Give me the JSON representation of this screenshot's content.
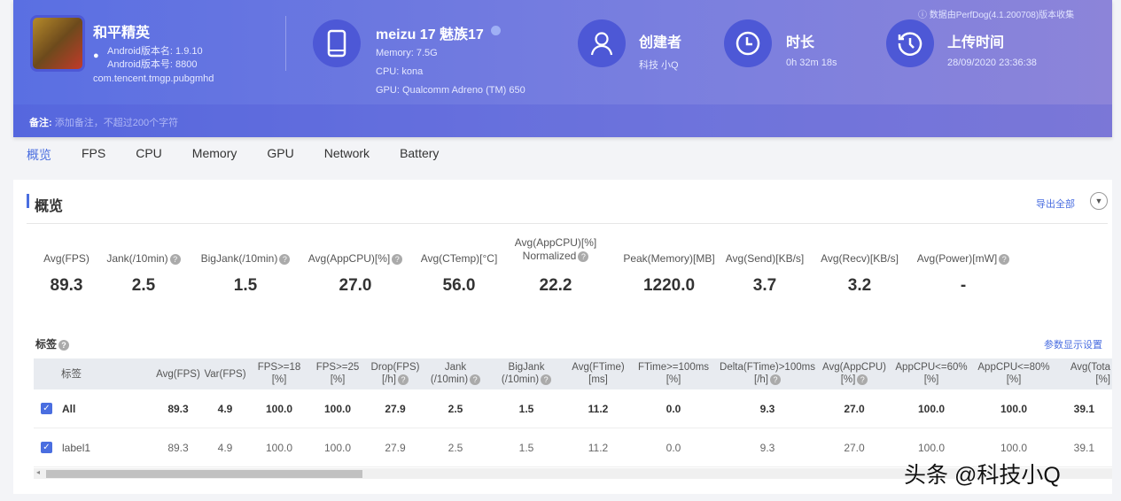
{
  "app": {
    "name": "和平精英",
    "version_name": "Android版本名: 1.9.10",
    "version_code": "Android版本号: 8800",
    "package": "com.tencent.tmgp.pubgmhd"
  },
  "device": {
    "name": "meizu 17 魅族17",
    "memory": "Memory: 7.5G",
    "cpu": "CPU: kona",
    "gpu": "GPU: Qualcomm Adreno (TM) 650"
  },
  "creator": {
    "label": "创建者",
    "value": "科技 小Q"
  },
  "duration": {
    "label": "时长",
    "value": "0h 32m 18s"
  },
  "upload": {
    "label": "上传时间",
    "value": "28/09/2020 23:36:38"
  },
  "perfdog_note": "数据由PerfDog(4.1.200708)版本收集",
  "note": {
    "label": "备注:",
    "placeholder": "添加备注，不超过200个字符"
  },
  "tabs": [
    "概览",
    "FPS",
    "CPU",
    "Memory",
    "GPU",
    "Network",
    "Battery"
  ],
  "section": {
    "title": "概览",
    "export": "导出全部"
  },
  "metrics": [
    {
      "label": "Avg(FPS)",
      "value": "89.3"
    },
    {
      "label": "Jank(/10min)",
      "value": "2.5"
    },
    {
      "label": "BigJank(/10min)",
      "value": "1.5"
    },
    {
      "label": "Avg(AppCPU)[%]",
      "value": "27.0"
    },
    {
      "label": "Avg(CTemp)[°C]",
      "value": "56.0"
    },
    {
      "label": "Avg(AppCPU)[%]",
      "label2": "Normalized",
      "value": "22.2"
    },
    {
      "label": "Peak(Memory)[MB]",
      "value": "1220.0"
    },
    {
      "label": "Avg(Send)[KB/s]",
      "value": "3.7"
    },
    {
      "label": "Avg(Recv)[KB/s]",
      "value": "3.2"
    },
    {
      "label": "Avg(Power)[mW]",
      "value": "-"
    }
  ],
  "labels_section": {
    "title": "标签",
    "settings": "参数显示设置"
  },
  "table": {
    "headers": [
      [
        "标签",
        ""
      ],
      [
        "Avg(FPS)",
        ""
      ],
      [
        "Var(FPS)",
        ""
      ],
      [
        "FPS>=18",
        "[%]"
      ],
      [
        "FPS>=25",
        "[%]"
      ],
      [
        "Drop(FPS)",
        "[/h]"
      ],
      [
        "Jank",
        "(/10min)"
      ],
      [
        "BigJank",
        "(/10min)"
      ],
      [
        "Avg(FTime)",
        "[ms]"
      ],
      [
        "FTime>=100ms",
        "[%]"
      ],
      [
        "Delta(FTime)>100ms",
        "[/h]"
      ],
      [
        "Avg(AppCPU)",
        "[%]"
      ],
      [
        "AppCPU<=60%",
        "[%]"
      ],
      [
        "AppCPU<=80%",
        "[%]"
      ],
      [
        "Avg(Tota",
        "[%]"
      ]
    ],
    "rows": [
      {
        "label": "All",
        "values": [
          "89.3",
          "4.9",
          "100.0",
          "100.0",
          "27.9",
          "2.5",
          "1.5",
          "11.2",
          "0.0",
          "9.3",
          "27.0",
          "100.0",
          "100.0",
          "39.1"
        ]
      },
      {
        "label": "label1",
        "values": [
          "89.3",
          "4.9",
          "100.0",
          "100.0",
          "27.9",
          "2.5",
          "1.5",
          "11.2",
          "0.0",
          "9.3",
          "27.0",
          "100.0",
          "100.0",
          "39.1"
        ]
      }
    ]
  },
  "watermark": "头条 @科技小Q"
}
